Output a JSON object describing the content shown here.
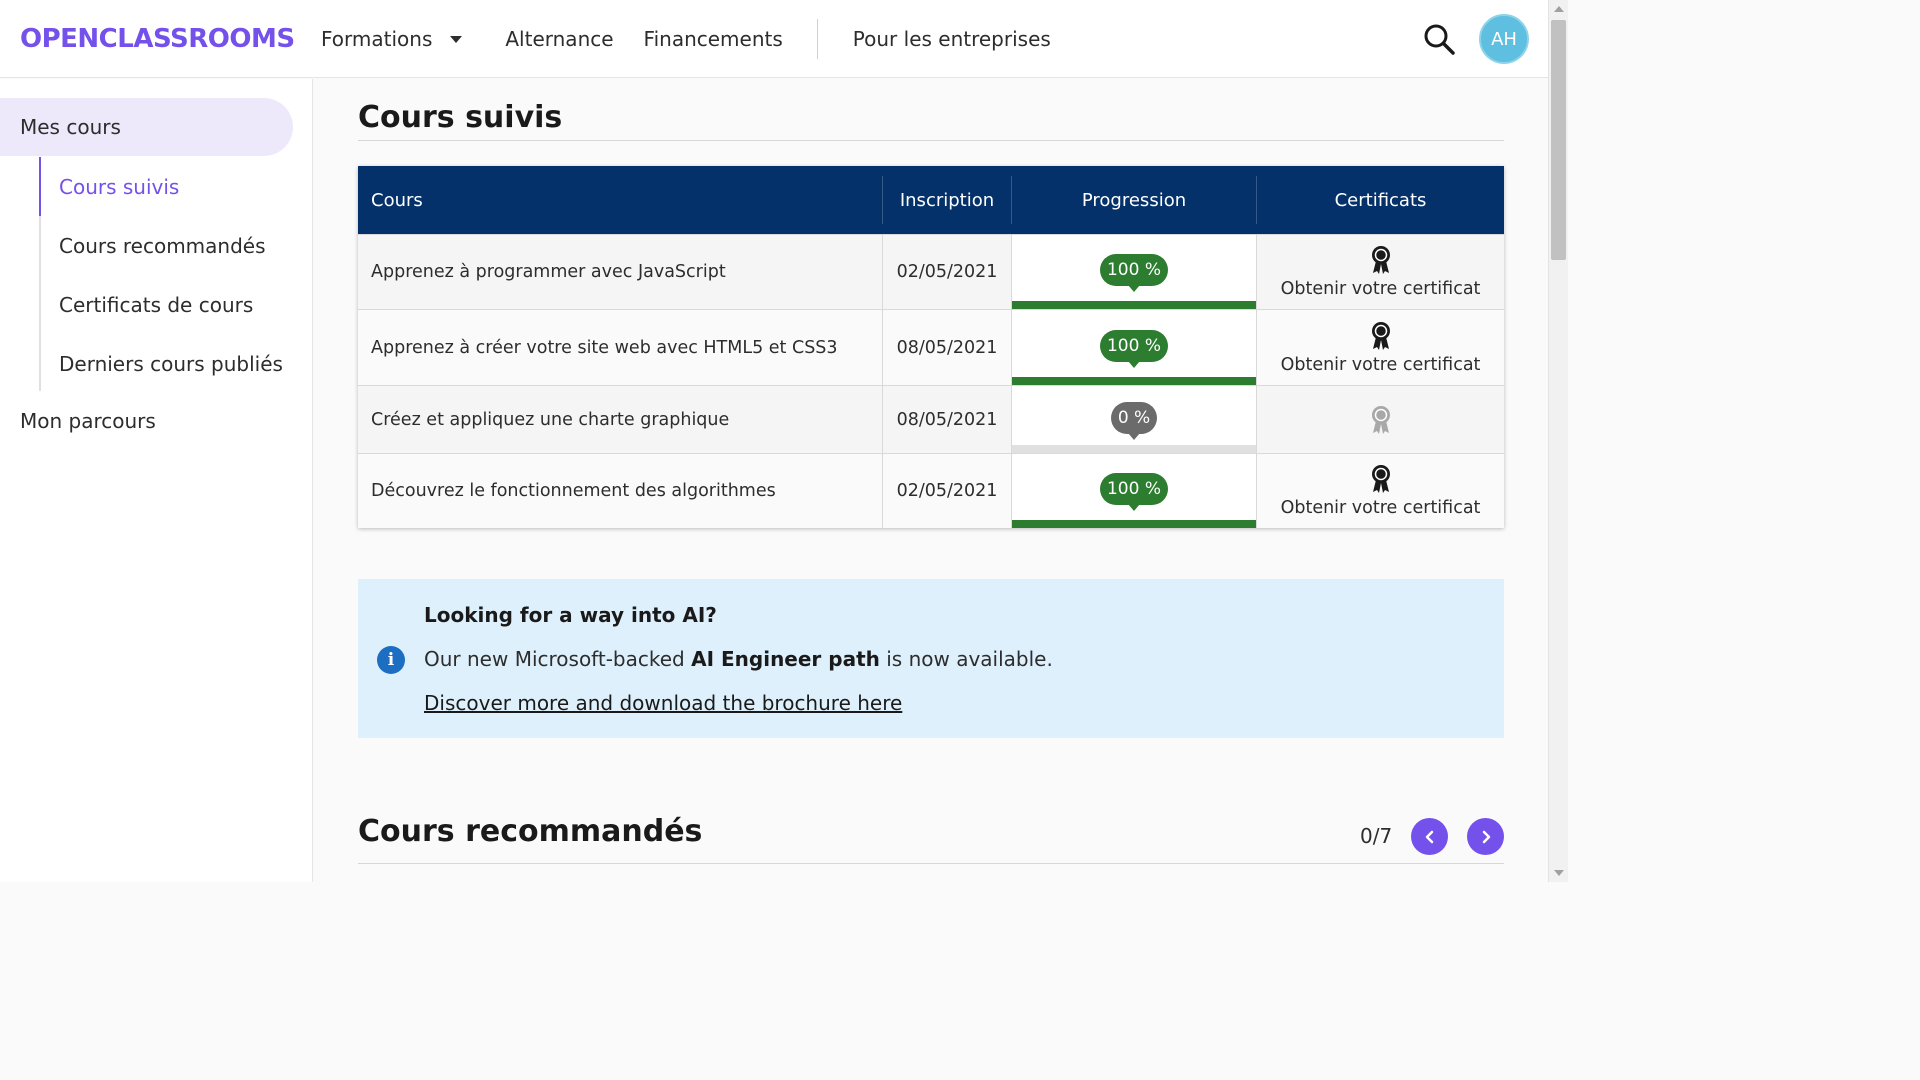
{
  "header": {
    "logo": "OPENCLASSROOMS",
    "nav": {
      "formations": "Formations",
      "alternance": "Alternance",
      "financements": "Financements",
      "entreprises": "Pour les entreprises"
    },
    "avatar_initials": "AH"
  },
  "sidebar": {
    "main": "Mes cours",
    "items": [
      "Cours suivis",
      "Cours recommandés",
      "Certificats de cours",
      "Derniers cours publiés"
    ],
    "active_item": "Cours suivis",
    "parcours": "Mon parcours"
  },
  "main": {
    "title": "Cours suivis",
    "table": {
      "headers": {
        "cours": "Cours",
        "inscription": "Inscription",
        "progression": "Progression",
        "certificats": "Certificats"
      },
      "rows": [
        {
          "cours": "Apprenez à programmer avec JavaScript",
          "inscription": "02/05/2021",
          "progression": "100 %",
          "progress_value": 1.0,
          "certificat": "Obtenir votre certificat"
        },
        {
          "cours": "Apprenez à créer votre site web avec HTML5 et CSS3",
          "inscription": "08/05/2021",
          "progression": "100 %",
          "progress_value": 1.0,
          "certificat": "Obtenir votre certificat"
        },
        {
          "cours": "Créez et appliquez une charte graphique",
          "inscription": "08/05/2021",
          "progression": "0 %",
          "progress_value": 0.0,
          "certificat": ""
        },
        {
          "cours": "Découvrez le fonctionnement des algorithmes",
          "inscription": "02/05/2021",
          "progression": "100 %",
          "progress_value": 1.0,
          "certificat": "Obtenir votre certificat"
        }
      ]
    }
  },
  "info": {
    "title": "Looking for a way into AI?",
    "text_before": "Our new Microsoft-backed ",
    "text_bold": "AI Engineer path",
    "text_after": " is now available.",
    "link": "Discover more and download the brochure here"
  },
  "recommended": {
    "title": "Cours recommandés",
    "count": "0/7"
  },
  "colors": {
    "brand": "#7451eb",
    "table_header": "#04316a",
    "progress_done": "#2c7d2f",
    "progress_zero": "#6b6b6b",
    "info_bg": "#dff0fd",
    "avatar": "#5fbfe0"
  }
}
